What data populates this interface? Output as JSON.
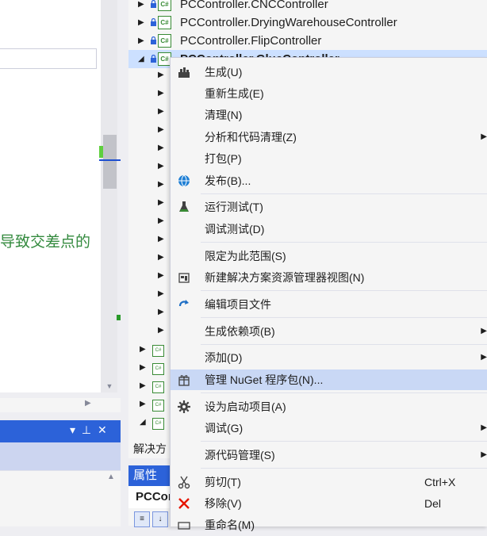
{
  "editor": {
    "visible_text": "导致交差点的"
  },
  "solution_explorer": {
    "tab_label": "解决方",
    "projects": [
      {
        "name": "PCController.CNCController",
        "expanded": false
      },
      {
        "name": "PCController.DryingWarehouseController",
        "expanded": false
      },
      {
        "name": "PCController.FlipController",
        "expanded": false
      },
      {
        "name": "PCController.GlueController",
        "expanded": true
      }
    ],
    "icon_text": "C#"
  },
  "properties": {
    "header": "属性",
    "object_name": "PCCon"
  },
  "context_menu": {
    "items": [
      {
        "label": "生成(U)",
        "icon": "build-icon"
      },
      {
        "label": "重新生成(E)"
      },
      {
        "label": "清理(N)"
      },
      {
        "label": "分析和代码清理(Z)",
        "submenu": true
      },
      {
        "label": "打包(P)"
      },
      {
        "label": "发布(B)...",
        "icon": "globe-icon"
      },
      {
        "label": "运行测试(T)",
        "icon": "flask-icon"
      },
      {
        "label": "调试测试(D)"
      },
      {
        "label": "限定为此范围(S)"
      },
      {
        "label": "新建解决方案资源管理器视图(N)",
        "icon": "new-view-icon"
      },
      {
        "label": "编辑项目文件",
        "icon": "refresh-arrow-icon"
      },
      {
        "label": "生成依赖项(B)",
        "submenu": true
      },
      {
        "label": "添加(D)",
        "submenu": true
      },
      {
        "label": "管理 NuGet 程序包(N)...",
        "icon": "nuget-package-icon",
        "highlighted": true
      },
      {
        "label": "设为启动项目(A)",
        "icon": "gear-icon"
      },
      {
        "label": "调试(G)",
        "submenu": true
      },
      {
        "label": "源代码管理(S)",
        "submenu": true
      },
      {
        "label": "剪切(T)",
        "shortcut": "Ctrl+X",
        "icon": "scissors-icon"
      },
      {
        "label": "移除(V)",
        "shortcut": "Del",
        "icon": "remove-x-icon"
      },
      {
        "label": "重命名(M)"
      }
    ]
  },
  "colors": {
    "accent": "#2c62d9",
    "highlight": "#c9d8f5",
    "selection": "#cce0ff",
    "remove": "#e51400",
    "csharp_green": "#388a34",
    "editor_text_green": "#338a3e"
  }
}
